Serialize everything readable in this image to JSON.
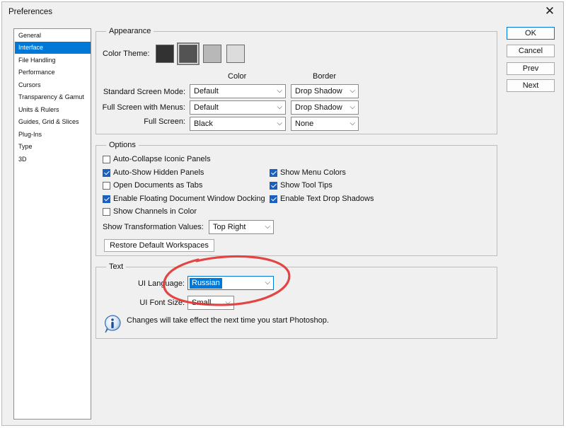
{
  "window": {
    "title": "Preferences",
    "close_glyph": "✕"
  },
  "sidebar": {
    "items": [
      {
        "label": "General",
        "selected": false
      },
      {
        "label": "Interface",
        "selected": true
      },
      {
        "label": "File Handling",
        "selected": false
      },
      {
        "label": "Performance",
        "selected": false
      },
      {
        "label": "Cursors",
        "selected": false
      },
      {
        "label": "Transparency & Gamut",
        "selected": false
      },
      {
        "label": "Units & Rulers",
        "selected": false
      },
      {
        "label": "Guides, Grid & Slices",
        "selected": false
      },
      {
        "label": "Plug-Ins",
        "selected": false
      },
      {
        "label": "Type",
        "selected": false
      },
      {
        "label": "3D",
        "selected": false
      }
    ]
  },
  "appearance": {
    "group_label": "Appearance",
    "color_theme_label": "Color Theme:",
    "themes": [
      {
        "color": "#323232",
        "selected": false
      },
      {
        "color": "#535353",
        "selected": true
      },
      {
        "color": "#b8b8b8",
        "selected": false
      },
      {
        "color": "#dcdcdc",
        "selected": false
      }
    ],
    "col_color": "Color",
    "col_border": "Border",
    "rows": [
      {
        "label": "Standard Screen Mode:",
        "color": "Default",
        "border": "Drop Shadow"
      },
      {
        "label": "Full Screen with Menus:",
        "color": "Default",
        "border": "Drop Shadow"
      },
      {
        "label": "Full Screen:",
        "color": "Black",
        "border": "None"
      }
    ],
    "arrow": "⌵"
  },
  "options": {
    "group_label": "Options",
    "left": [
      {
        "label": "Auto-Collapse Iconic Panels",
        "checked": false
      },
      {
        "label": "Auto-Show Hidden Panels",
        "checked": true
      },
      {
        "label": "Open Documents as Tabs",
        "checked": false
      },
      {
        "label": "Enable Floating Document Window Docking",
        "checked": true
      },
      {
        "label": "Show Channels in Color",
        "checked": false
      }
    ],
    "right": [
      {
        "label": "Show Menu Colors",
        "checked": true
      },
      {
        "label": "Show Tool Tips",
        "checked": true
      },
      {
        "label": "Enable Text Drop Shadows",
        "checked": true
      }
    ],
    "transform_label": "Show Transformation Values:",
    "transform_value": "Top Right",
    "restore_button": "Restore Default Workspaces"
  },
  "text_group": {
    "group_label": "Text",
    "ui_language_label": "UI Language:",
    "ui_language_value": "Russian",
    "ui_font_size_label": "UI Font Size:",
    "ui_font_size_value": "Small",
    "notice": "Changes will take effect the next time you start Photoshop."
  },
  "buttons": {
    "ok": "OK",
    "cancel": "Cancel",
    "prev": "Prev",
    "next": "Next"
  },
  "colors": {
    "accent": "#0078d7",
    "annotation": "#e0322f"
  }
}
